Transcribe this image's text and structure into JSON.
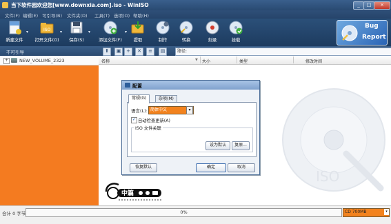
{
  "window": {
    "title": "当下软件园欢迎您[www.downxia.com].iso - WinISO",
    "min_label": "_",
    "max_label": "□",
    "close_label": "×"
  },
  "menu": [
    "文件(F)",
    "编辑(E)",
    "可引导(B)",
    "文件夹(D)",
    "工具(T)",
    "选项(O)",
    "帮助(H)"
  ],
  "toolbar": {
    "items": [
      {
        "label": "新建文件",
        "icon": "new-file-icon"
      },
      {
        "label": "打开文件(O)",
        "icon": "open-iso-icon"
      },
      {
        "label": "保存(S)",
        "icon": "save-icon"
      },
      {
        "label": "添加文件(F)",
        "icon": "add-file-icon"
      },
      {
        "label": "提取",
        "icon": "extract-icon"
      },
      {
        "label": "制作",
        "icon": "make-icon"
      },
      {
        "label": "转换",
        "icon": "convert-icon"
      },
      {
        "label": "刻录",
        "icon": "burn-icon"
      },
      {
        "label": "挂载",
        "icon": "mount-icon"
      }
    ],
    "dropdown_glyph": "▾",
    "bug_report": {
      "line1": "Bug",
      "line2": "Report"
    }
  },
  "subbar": {
    "left_text": "不可引导",
    "path_label": "路径:",
    "icons": [
      "folder-up-icon",
      "new-folder-icon",
      "add-icon",
      "delete-icon",
      "properties-icon",
      "view-icon"
    ]
  },
  "tree": {
    "expander": "+",
    "root": "NEW_VOLUME_2323"
  },
  "columns": [
    "名称",
    "大小",
    "类型",
    "修改时间"
  ],
  "sort_glyph": "▼",
  "dialog": {
    "title": "配置",
    "tabs": [
      "常规(G)",
      "杂项(M)"
    ],
    "language_label": "语言(L):",
    "language_value": "简体中文",
    "autocheck_label": "自动检查更新(A)",
    "autocheck_checked": true,
    "group_label": "ISO 文件关联",
    "set_default": "设为默认",
    "restore": "复原...",
    "restore_default": "恢复默认",
    "ok": "确定",
    "cancel": "取消"
  },
  "logo_text": "中篇",
  "watermark_text": "ISO",
  "status": {
    "left": "合计 0 字节",
    "progress": "0%",
    "progress_value": 0,
    "media": "CD 700MB"
  }
}
